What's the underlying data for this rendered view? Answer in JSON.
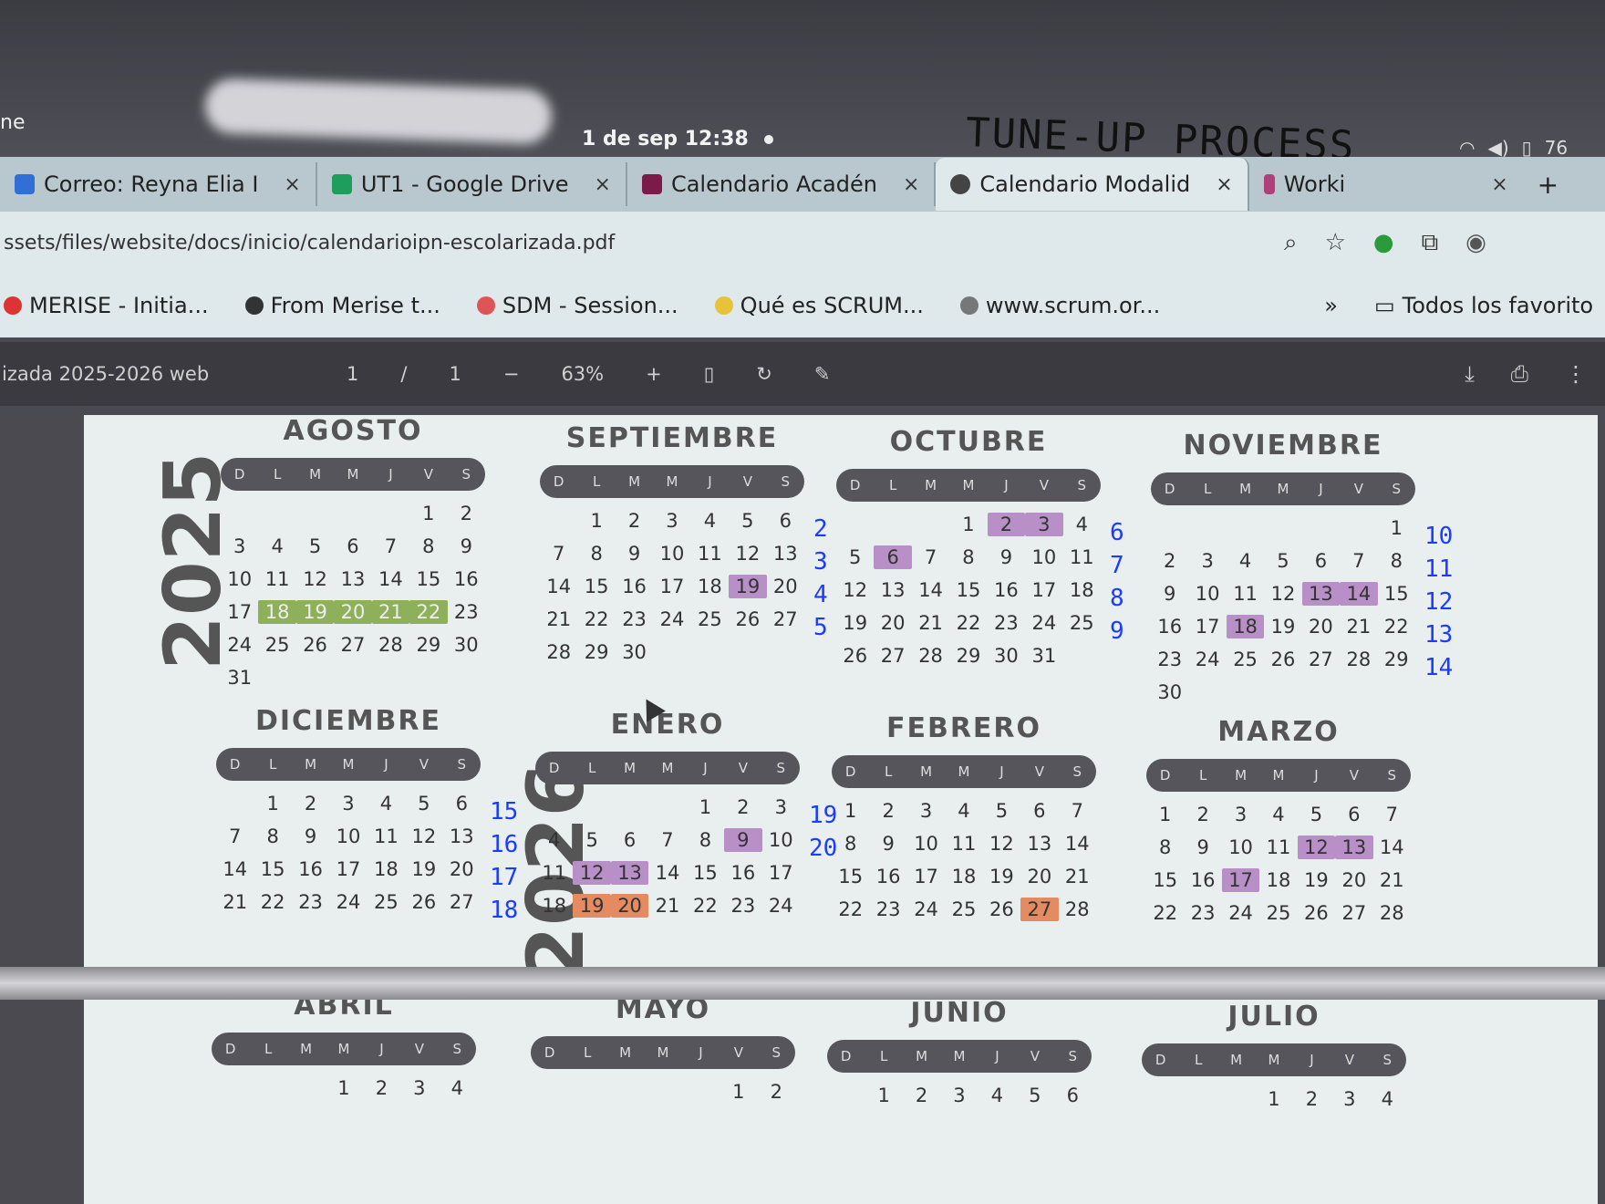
{
  "status": {
    "left_text": "ne",
    "time": "1 de sep 12:38",
    "battery": "76"
  },
  "handwriting": "TUNE-UP PROCESS",
  "tabs": [
    {
      "label": "Correo: Reyna Elia I",
      "color": "#2f6fd6"
    },
    {
      "label": "UT1 - Google Drive",
      "color": "#1e9e5a"
    },
    {
      "label": "Calendario Acadén",
      "color": "#7a1b4a"
    },
    {
      "label": "Calendario Modalid",
      "color": "#444444"
    },
    {
      "label": "Worki",
      "color": "#b0407a"
    }
  ],
  "address": {
    "url": "ssets/files/website/docs/inicio/calendarioipn-escolarizada.pdf"
  },
  "bookmarks": [
    {
      "label": "MERISE - Initia...",
      "color": "#d33"
    },
    {
      "label": "From Merise t...",
      "color": "#333"
    },
    {
      "label": "SDM - Session...",
      "color": "#d55"
    },
    {
      "label": "Qué es SCRUM...",
      "color": "#e8c23a"
    },
    {
      "label": "www.scrum.or...",
      "color": "#555"
    }
  ],
  "bookmarks_more": "»",
  "bookmarks_all": "Todos los favorito",
  "pdf": {
    "title": "izada 2025-2026 web",
    "page": "1",
    "page_sep": "/",
    "page_total": "1",
    "zoom": "63%"
  },
  "years": {
    "y1": "2025",
    "y2": "2026"
  },
  "weekdays": [
    "D",
    "L",
    "M",
    "M",
    "J",
    "V",
    "S"
  ],
  "months": [
    {
      "name": "AGOSTO",
      "days": [
        "",
        "",
        "",
        "",
        "",
        "1",
        "2",
        "3",
        "4",
        "5",
        "6",
        "7",
        "8",
        "9",
        "10",
        "11",
        "12",
        "13",
        "14",
        "15",
        "16",
        "17",
        "18",
        "19",
        "20",
        "21",
        "22",
        "23",
        "24",
        "25",
        "26",
        "27",
        "28",
        "29",
        "30",
        "31"
      ],
      "weeknos": []
    },
    {
      "name": "SEPTIEMBRE",
      "days": [
        "",
        "1",
        "2",
        "3",
        "4",
        "5",
        "6",
        "7",
        "8",
        "9",
        "10",
        "11",
        "12",
        "13",
        "14",
        "15",
        "16",
        "17",
        "18",
        "19",
        "20",
        "21",
        "22",
        "23",
        "24",
        "25",
        "26",
        "27",
        "28",
        "29",
        "30"
      ],
      "weeknos": [
        "2",
        "3",
        "4",
        "5"
      ]
    },
    {
      "name": "OCTUBRE",
      "days": [
        "",
        "",
        "",
        "1",
        "2",
        "3",
        "4",
        "5",
        "6",
        "7",
        "8",
        "9",
        "10",
        "11",
        "12",
        "13",
        "14",
        "15",
        "16",
        "17",
        "18",
        "19",
        "20",
        "21",
        "22",
        "23",
        "24",
        "25",
        "26",
        "27",
        "28",
        "29",
        "30",
        "31"
      ],
      "weeknos": [
        "6",
        "7",
        "8",
        "9"
      ]
    },
    {
      "name": "NOVIEMBRE",
      "days": [
        "",
        "",
        "",
        "",
        "",
        "",
        "1",
        "2",
        "3",
        "4",
        "5",
        "6",
        "7",
        "8",
        "9",
        "10",
        "11",
        "12",
        "13",
        "14",
        "15",
        "16",
        "17",
        "18",
        "19",
        "20",
        "21",
        "22",
        "23",
        "24",
        "25",
        "26",
        "27",
        "28",
        "29",
        "30"
      ],
      "weeknos": [
        "10",
        "11",
        "12",
        "13",
        "14"
      ]
    },
    {
      "name": "DICIEMBRE",
      "days": [
        "",
        "1",
        "2",
        "3",
        "4",
        "5",
        "6",
        "7",
        "8",
        "9",
        "10",
        "11",
        "12",
        "13",
        "14",
        "15",
        "16",
        "17",
        "18",
        "19",
        "20",
        "21",
        "22",
        "23",
        "24",
        "25",
        "26",
        "27"
      ],
      "weeknos": [
        "15",
        "16",
        "17",
        "18"
      ]
    },
    {
      "name": "ENERO",
      "days": [
        "",
        "",
        "",
        "",
        "1",
        "2",
        "3",
        "4",
        "5",
        "6",
        "7",
        "8",
        "9",
        "10",
        "11",
        "12",
        "13",
        "14",
        "15",
        "16",
        "17",
        "18",
        "19",
        "20",
        "21",
        "22",
        "23",
        "24"
      ],
      "weeknos": [
        "19",
        "20"
      ]
    },
    {
      "name": "FEBRERO",
      "days": [
        "1",
        "2",
        "3",
        "4",
        "5",
        "6",
        "7",
        "8",
        "9",
        "10",
        "11",
        "12",
        "13",
        "14",
        "15",
        "16",
        "17",
        "18",
        "19",
        "20",
        "21",
        "22",
        "23",
        "24",
        "25",
        "26",
        "27",
        "28"
      ],
      "weeknos": []
    },
    {
      "name": "MARZO",
      "days": [
        "1",
        "2",
        "3",
        "4",
        "5",
        "6",
        "7",
        "8",
        "9",
        "10",
        "11",
        "12",
        "13",
        "14",
        "15",
        "16",
        "17",
        "18",
        "19",
        "20",
        "21",
        "22",
        "23",
        "24",
        "25",
        "26",
        "27",
        "28"
      ],
      "weeknos": []
    },
    {
      "name": "ABRIL",
      "days": [
        "",
        "",
        "",
        "1",
        "2",
        "3",
        "4"
      ],
      "weeknos": []
    },
    {
      "name": "MAYO",
      "days": [
        "",
        "",
        "",
        "",
        "",
        "1",
        "2"
      ],
      "weeknos": []
    },
    {
      "name": "JUNIO",
      "days": [
        "",
        "1",
        "2",
        "3",
        "4",
        "5",
        "6"
      ],
      "weeknos": []
    },
    {
      "name": "JULIO",
      "days": [
        "",
        "",
        "",
        "1",
        "2",
        "3",
        "4"
      ],
      "weeknos": []
    }
  ],
  "highlights": {
    "purple": [
      "SEPTIEMBRE-19",
      "OCTUBRE-2",
      "OCTUBRE-3",
      "OCTUBRE-6",
      "NOVIEMBRE-13",
      "NOVIEMBRE-14",
      "NOVIEMBRE-18",
      "ENERO-9",
      "ENERO-12",
      "ENERO-13",
      "MARZO-12",
      "MARZO-13",
      "MARZO-17"
    ],
    "orange": [
      "FEBRERO-27",
      "ENERO-19",
      "ENERO-20"
    ],
    "green": [
      "AGOSTO-18",
      "AGOSTO-19",
      "AGOSTO-20",
      "AGOSTO-21",
      "AGOSTO-22"
    ]
  }
}
